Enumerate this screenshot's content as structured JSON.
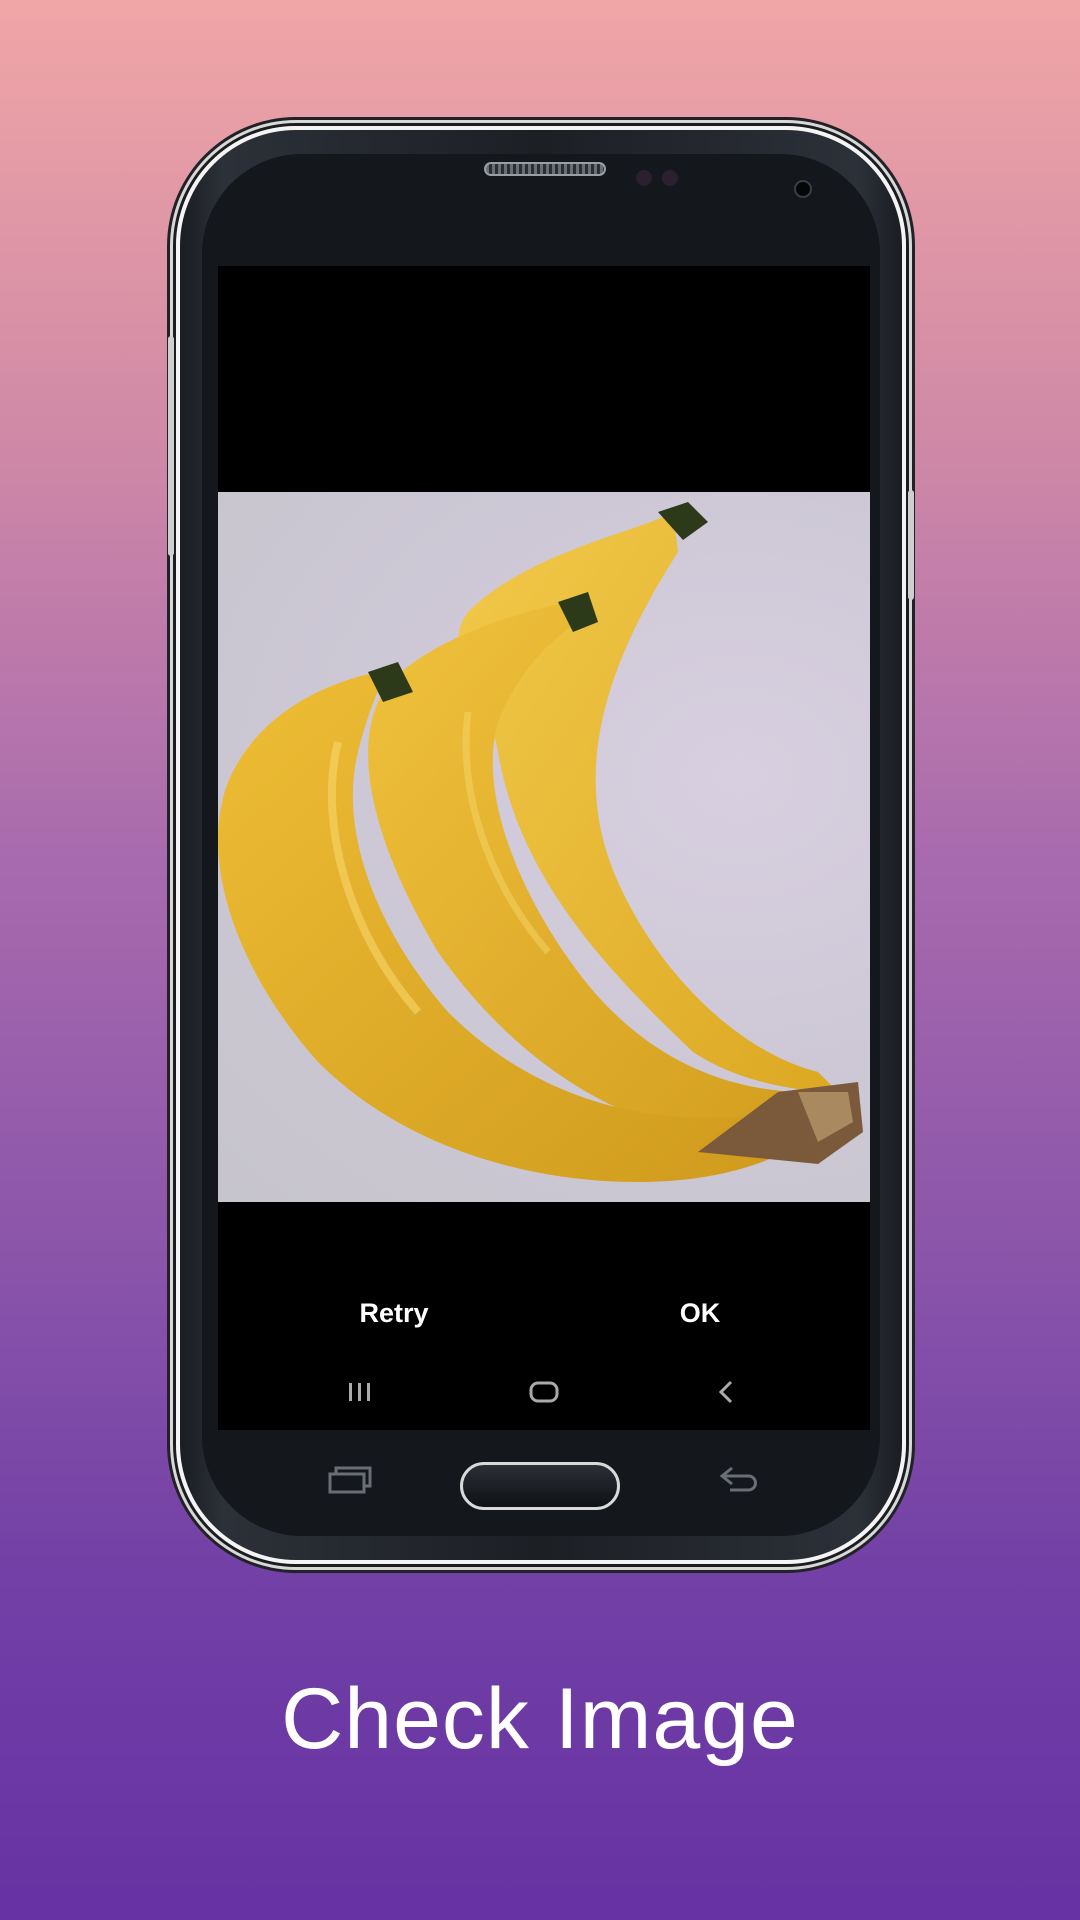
{
  "screen": {
    "retry_label": "Retry",
    "ok_label": "OK"
  },
  "caption": "Check Image",
  "icons": {
    "nav_recent": "recent-apps-icon",
    "nav_home": "home-icon",
    "nav_back": "back-icon"
  },
  "colors": {
    "gradient_top": "#f0a6a6",
    "gradient_bottom": "#6632a4",
    "banana": "#e9bd2e"
  }
}
